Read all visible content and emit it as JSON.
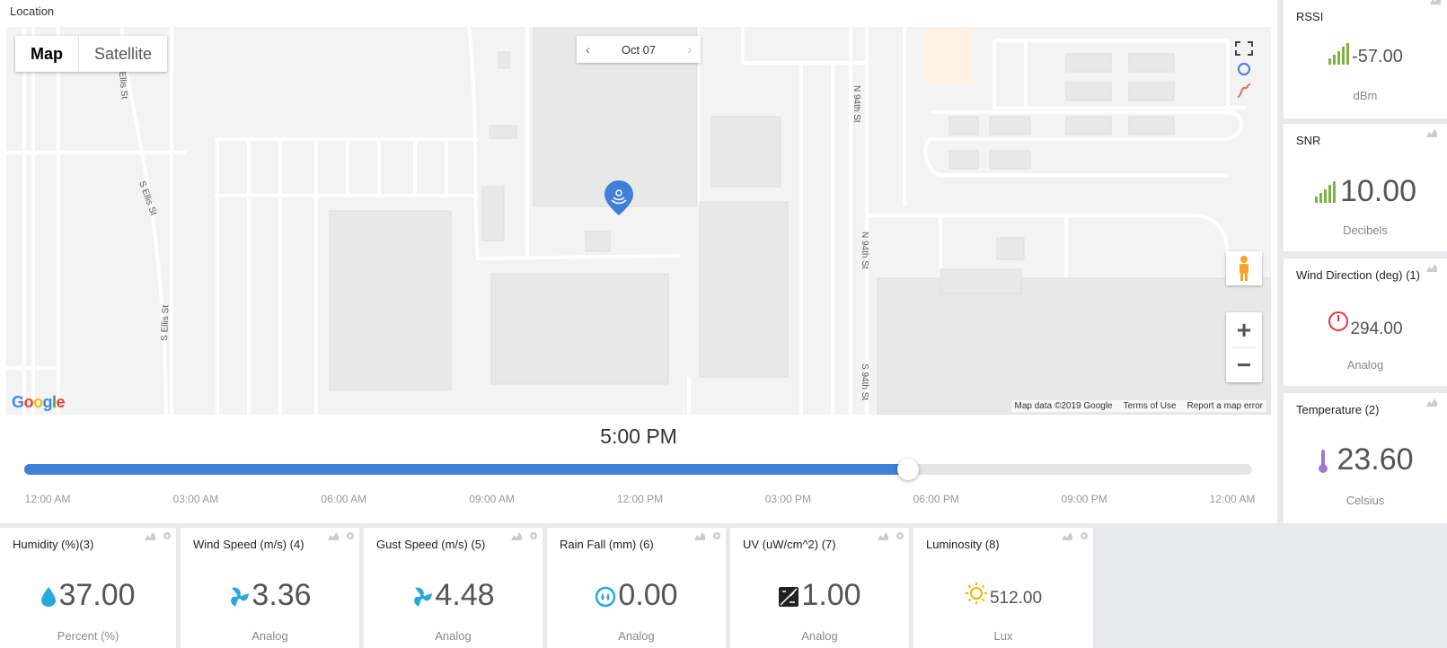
{
  "location": {
    "title": "Location",
    "map_type": {
      "map": "Map",
      "satellite": "Satellite"
    },
    "date": {
      "prev": "‹",
      "label": "Oct 07",
      "next": "›"
    },
    "streets": [
      "Ellis St",
      "S Ellis St",
      "S Ellis St",
      "N 94th St",
      "N 94th St",
      "S 94th St"
    ],
    "attribution": {
      "google": "Google",
      "data": "Map data ©2019 Google",
      "terms": "Terms of Use",
      "report": "Report a map error"
    },
    "zoom_in": "+",
    "zoom_out": "−",
    "time": "5:00 PM",
    "slider_position": 0.72,
    "ticks": [
      "12:00 AM",
      "03:00 AM",
      "06:00 AM",
      "09:00 AM",
      "12:00 PM",
      "03:00 PM",
      "06:00 PM",
      "09:00 PM",
      "12:00 AM"
    ]
  },
  "cards_right": [
    {
      "title": "RSSI",
      "value": "-57.00",
      "unit": "dBm",
      "icon": "signal-bars-icon"
    },
    {
      "title": "SNR",
      "value": "10.00",
      "unit": "Decibels",
      "icon": "signal-bars-icon"
    },
    {
      "title": "Wind Direction (deg) (1)",
      "value": "294.00",
      "unit": "Analog",
      "icon": "gauge-icon"
    },
    {
      "title": "Temperature (2)",
      "value": "23.60",
      "unit": "Celsius",
      "icon": "thermometer-icon"
    }
  ],
  "cards_bottom": [
    {
      "title": "Humidity (%)(3)",
      "value": "37.00",
      "unit": "Percent (%)",
      "icon": "water-drop-icon"
    },
    {
      "title": "Wind Speed (m/s) (4)",
      "value": "3.36",
      "unit": "Analog",
      "icon": "fan-icon"
    },
    {
      "title": "Gust Speed (m/s) (5)",
      "value": "4.48",
      "unit": "Analog",
      "icon": "fan-icon"
    },
    {
      "title": "Rain Fall (mm) (6)",
      "value": "0.00",
      "unit": "Analog",
      "icon": "rain-icon"
    },
    {
      "title": "UV (uW/cm^2) (7)",
      "value": "1.00",
      "unit": "Analog",
      "icon": "uv-icon"
    },
    {
      "title": "Luminosity (8)",
      "value": "512.00",
      "unit": "Lux",
      "icon": "sun-icon"
    }
  ],
  "colors": {
    "accent": "#3f80d9",
    "signal": "#7cb342",
    "gauge": "#e53935",
    "thermo": "#9c7bd1",
    "blue_icon": "#29a8e0",
    "sun": "#f5b400"
  }
}
